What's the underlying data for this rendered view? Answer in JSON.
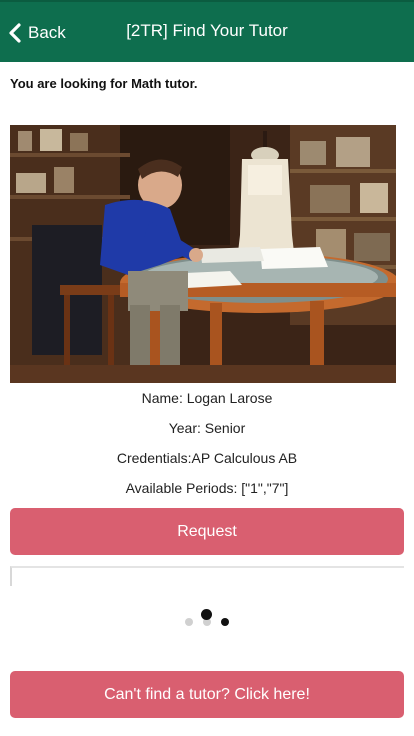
{
  "header": {
    "back_label": "Back",
    "title": "[2TR] Find Your Tutor",
    "bg_color": "#0e6e4e"
  },
  "subtitle": "You are looking for Math tutor.",
  "tutor": {
    "name": "Name: Logan Larose",
    "year": "Year: Senior",
    "credentials": "Credentials:AP Calculous AB",
    "periods": "Available Periods: [\"1\",\"7\"]"
  },
  "buttons": {
    "request_label": "Request",
    "cant_find_label": "Can't find a tutor? Click here!",
    "color": "#d95f70"
  },
  "carousel": {
    "page_count": 3,
    "active_index": 1
  }
}
